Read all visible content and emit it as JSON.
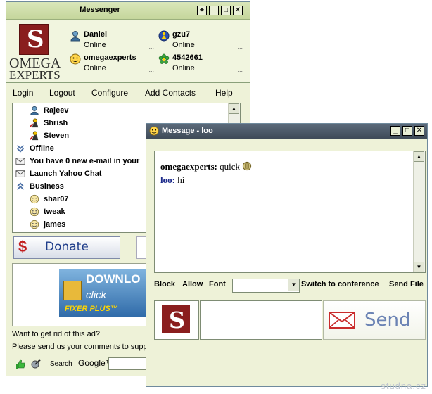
{
  "messenger": {
    "title": "Messenger",
    "logo_line1": "OMEGA",
    "logo_line2": "EXPERTS",
    "contacts": [
      {
        "name": "Daniel",
        "status": "Online",
        "icon": "user-icon"
      },
      {
        "name": "gzu7",
        "status": "Online",
        "icon": "yahoo-user-icon"
      },
      {
        "name": "omegaexperts",
        "status": "Online",
        "icon": "smiley-icon"
      },
      {
        "name": "4542661",
        "status": "Online",
        "icon": "icq-flower-icon"
      }
    ],
    "dots": "...",
    "menu": {
      "login": "Login",
      "logout": "Logout",
      "configure": "Configure",
      "add_contacts": "Add Contacts",
      "help": "Help"
    },
    "buddies": [
      {
        "label": "Rajeev",
        "icon": "user-icon"
      },
      {
        "label": "Shrish",
        "icon": "aim-user-icon"
      },
      {
        "label": "Steven",
        "icon": "aim-user-icon"
      },
      {
        "label": "Offline",
        "icon": "collapse-icon"
      },
      {
        "label": "You have 0 new e-mail in your",
        "icon": "mail-icon"
      },
      {
        "label": "Launch Yahoo Chat",
        "icon": "mail-icon"
      },
      {
        "label": "Business",
        "icon": "expand-icon"
      },
      {
        "label": "shar07",
        "icon": "smiley-icon"
      },
      {
        "label": "tweak",
        "icon": "smiley-icon"
      },
      {
        "label": "james",
        "icon": "smiley-icon"
      }
    ],
    "donate_label": "Donate",
    "ad": {
      "line1": "DOWNLO",
      "line2": "click",
      "line3": "FIXER PLUS™"
    },
    "ad_text1": "Want to get rid of this ad?",
    "ad_text2": "Please send us your comments to supp",
    "search_label": "Search",
    "google_label": "Google™"
  },
  "message_window": {
    "title": "Message - loo",
    "chat": [
      {
        "name": "omegaexperts:",
        "text": "quick",
        "name_color": "#000000"
      },
      {
        "name": "loo:",
        "text": "hi",
        "name_color": "#1c2a8a"
      }
    ],
    "tools": {
      "block": "Block",
      "allow": "Allow",
      "font": "Font",
      "switch": "Switch to conference",
      "send_file": "Send File"
    },
    "send_label": "Send"
  },
  "watermark": "studna.cz"
}
